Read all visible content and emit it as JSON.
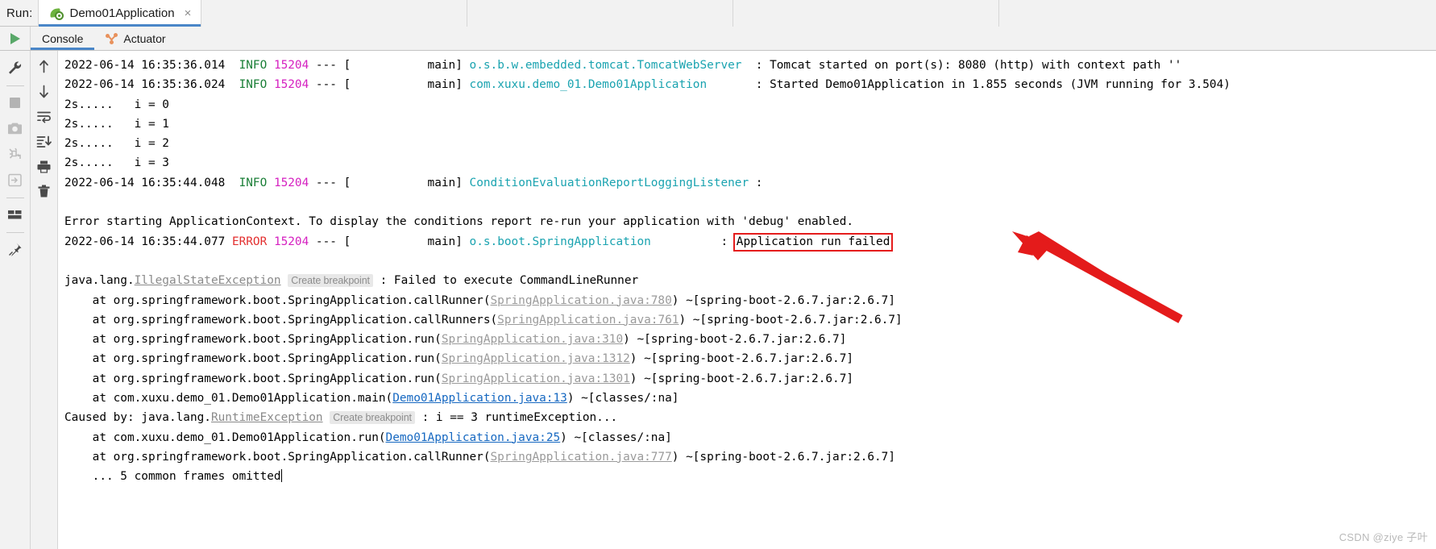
{
  "window": {
    "run_label": "Run:",
    "run_tab_title": "Demo01Application",
    "close_glyph": "×"
  },
  "subtabs": [
    {
      "label": "Console",
      "icon": "console-icon",
      "active": true
    },
    {
      "label": "Actuator",
      "icon": "actuator-icon",
      "active": false
    }
  ],
  "left_toolbar": [
    {
      "name": "rerun-icon",
      "title": "Rerun"
    },
    {
      "name": "wrench-icon",
      "title": "Edit Configuration"
    },
    {
      "name": "stop-icon",
      "title": "Stop"
    },
    {
      "name": "camera-icon",
      "title": "Snapshot"
    },
    {
      "name": "thread-dump-icon",
      "title": "Thread Dump"
    },
    {
      "name": "exit-icon",
      "title": "Restore Layout"
    },
    {
      "name": "layout-icon",
      "title": "Layout Settings"
    },
    {
      "name": "pin-icon",
      "title": "Pin Tab"
    }
  ],
  "console_toolbar": [
    {
      "name": "up-arrow-icon",
      "title": "Up the Stack Trace"
    },
    {
      "name": "down-arrow-icon",
      "title": "Down the Stack Trace"
    },
    {
      "name": "soft-wrap-icon",
      "title": "Use Soft Wraps"
    },
    {
      "name": "scroll-end-icon",
      "title": "Scroll to the End"
    },
    {
      "name": "print-icon",
      "title": "Print"
    },
    {
      "name": "trash-icon",
      "title": "Clear All"
    }
  ],
  "annotation": {
    "highlight_text": "Application run failed",
    "highlight_color": "#e51c1c",
    "arrow_color": "#e41b1b"
  },
  "watermark": "CSDN @ziye 子叶",
  "console": {
    "lines": [
      {
        "id": "log-tomcat-started",
        "segments": [
          {
            "t": "2022-06-14 16:35:36.014  ",
            "c": "plain"
          },
          {
            "t": "INFO",
            "c": "info"
          },
          {
            "t": " ",
            "c": "plain"
          },
          {
            "t": "15204",
            "c": "pid"
          },
          {
            "t": " --- [           main] ",
            "c": "plain"
          },
          {
            "t": "o.s.b.w.embedded.tomcat.TomcatWebServer",
            "c": "logger"
          },
          {
            "t": "  : Tomcat started on port(s): 8080 (http) with context path ''",
            "c": "plain"
          }
        ]
      },
      {
        "id": "log-app-started",
        "segments": [
          {
            "t": "2022-06-14 16:35:36.024  ",
            "c": "plain"
          },
          {
            "t": "INFO",
            "c": "info"
          },
          {
            "t": " ",
            "c": "plain"
          },
          {
            "t": "15204",
            "c": "pid"
          },
          {
            "t": " --- [           main] ",
            "c": "plain"
          },
          {
            "t": "com.xuxu.demo_01.Demo01Application",
            "c": "logger"
          },
          {
            "t": "       : Started Demo01Application in 1.855 seconds (JVM running for 3.504)",
            "c": "plain"
          }
        ]
      },
      {
        "id": "out-i-0",
        "segments": [
          {
            "t": "2s.....   i = 0",
            "c": "plain"
          }
        ]
      },
      {
        "id": "out-i-1",
        "segments": [
          {
            "t": "2s.....   i = 1",
            "c": "plain"
          }
        ]
      },
      {
        "id": "out-i-2",
        "segments": [
          {
            "t": "2s.....   i = 2",
            "c": "plain"
          }
        ]
      },
      {
        "id": "out-i-3",
        "segments": [
          {
            "t": "2s.....   i = 3",
            "c": "plain"
          }
        ]
      },
      {
        "id": "log-condition-report",
        "segments": [
          {
            "t": "2022-06-14 16:35:44.048  ",
            "c": "plain"
          },
          {
            "t": "INFO",
            "c": "info"
          },
          {
            "t": " ",
            "c": "plain"
          },
          {
            "t": "15204",
            "c": "pid"
          },
          {
            "t": " --- [           main] ",
            "c": "plain"
          },
          {
            "t": "ConditionEvaluationReportLoggingListener",
            "c": "logger"
          },
          {
            "t": " :",
            "c": "plain"
          }
        ]
      },
      {
        "id": "blank-1",
        "segments": [
          {
            "t": " ",
            "c": "plain"
          }
        ]
      },
      {
        "id": "err-context-msg",
        "segments": [
          {
            "t": "Error starting ApplicationContext. To display the conditions report re-run your application with 'debug' enabled.",
            "c": "plain"
          }
        ]
      },
      {
        "id": "log-app-run-failed",
        "segments": [
          {
            "t": "2022-06-14 16:35:44.077 ",
            "c": "plain"
          },
          {
            "t": "ERROR",
            "c": "error"
          },
          {
            "t": " ",
            "c": "plain"
          },
          {
            "t": "15204",
            "c": "pid"
          },
          {
            "t": " --- [           main] ",
            "c": "plain"
          },
          {
            "t": "o.s.boot.SpringApplication",
            "c": "logger"
          },
          {
            "t": "          : ",
            "c": "plain"
          },
          {
            "t": "Application run failed",
            "c": "highlight"
          }
        ]
      },
      {
        "id": "blank-2",
        "segments": [
          {
            "t": " ",
            "c": "plain"
          }
        ]
      },
      {
        "id": "exc-illegalstate",
        "segments": [
          {
            "t": "java.lang.",
            "c": "plain"
          },
          {
            "t": "IllegalStateException",
            "c": "excp"
          },
          {
            "t": " ",
            "c": "plain"
          },
          {
            "t": "Create breakpoint",
            "c": "bphint"
          },
          {
            "t": " : Failed to execute CommandLineRunner",
            "c": "plain"
          }
        ]
      },
      {
        "id": "stack-callrunner-780",
        "segments": [
          {
            "t": "    at org.springframework.boot.SpringApplication.callRunner(",
            "c": "plain"
          },
          {
            "t": "SpringApplication.java:780",
            "c": "link"
          },
          {
            "t": ") ~[spring-boot-2.6.7.jar:2.6.7]",
            "c": "plain"
          }
        ]
      },
      {
        "id": "stack-callrunners-761",
        "segments": [
          {
            "t": "    at org.springframework.boot.SpringApplication.callRunners(",
            "c": "plain"
          },
          {
            "t": "SpringApplication.java:761",
            "c": "link"
          },
          {
            "t": ") ~[spring-boot-2.6.7.jar:2.6.7]",
            "c": "plain"
          }
        ]
      },
      {
        "id": "stack-run-310",
        "segments": [
          {
            "t": "    at org.springframework.boot.SpringApplication.run(",
            "c": "plain"
          },
          {
            "t": "SpringApplication.java:310",
            "c": "link"
          },
          {
            "t": ") ~[spring-boot-2.6.7.jar:2.6.7]",
            "c": "plain"
          }
        ]
      },
      {
        "id": "stack-run-1312",
        "segments": [
          {
            "t": "    at org.springframework.boot.SpringApplication.run(",
            "c": "plain"
          },
          {
            "t": "SpringApplication.java:1312",
            "c": "link"
          },
          {
            "t": ") ~[spring-boot-2.6.7.jar:2.6.7]",
            "c": "plain"
          }
        ]
      },
      {
        "id": "stack-run-1301",
        "segments": [
          {
            "t": "    at org.springframework.boot.SpringApplication.run(",
            "c": "plain"
          },
          {
            "t": "SpringApplication.java:1301",
            "c": "link"
          },
          {
            "t": ") ~[spring-boot-2.6.7.jar:2.6.7]",
            "c": "plain"
          }
        ]
      },
      {
        "id": "stack-demo-main-13",
        "segments": [
          {
            "t": "    at com.xuxu.demo_01.Demo01Application.main(",
            "c": "plain"
          },
          {
            "t": "Demo01Application.java:13",
            "c": "link-blue"
          },
          {
            "t": ") ~[classes/:na]",
            "c": "plain"
          }
        ]
      },
      {
        "id": "caused-by-runtime",
        "segments": [
          {
            "t": "Caused by: java.lang.",
            "c": "plain"
          },
          {
            "t": "RuntimeException",
            "c": "excp"
          },
          {
            "t": " ",
            "c": "plain"
          },
          {
            "t": "Create breakpoint",
            "c": "bphint"
          },
          {
            "t": " : i == 3 runtimeException...",
            "c": "plain"
          }
        ]
      },
      {
        "id": "stack-demo-run-25",
        "segments": [
          {
            "t": "    at com.xuxu.demo_01.Demo01Application.run(",
            "c": "plain"
          },
          {
            "t": "Demo01Application.java:25",
            "c": "link-blue"
          },
          {
            "t": ") ~[classes/:na]",
            "c": "plain"
          }
        ]
      },
      {
        "id": "stack-callrunner-777",
        "segments": [
          {
            "t": "    at org.springframework.boot.SpringApplication.callRunner(",
            "c": "plain"
          },
          {
            "t": "SpringApplication.java:777",
            "c": "link"
          },
          {
            "t": ") ~[spring-boot-2.6.7.jar:2.6.7]",
            "c": "plain"
          }
        ]
      },
      {
        "id": "frames-omitted",
        "segments": [
          {
            "t": "    ... 5 common frames omitted",
            "c": "plain"
          },
          {
            "t": "",
            "c": "caret"
          }
        ]
      }
    ]
  }
}
